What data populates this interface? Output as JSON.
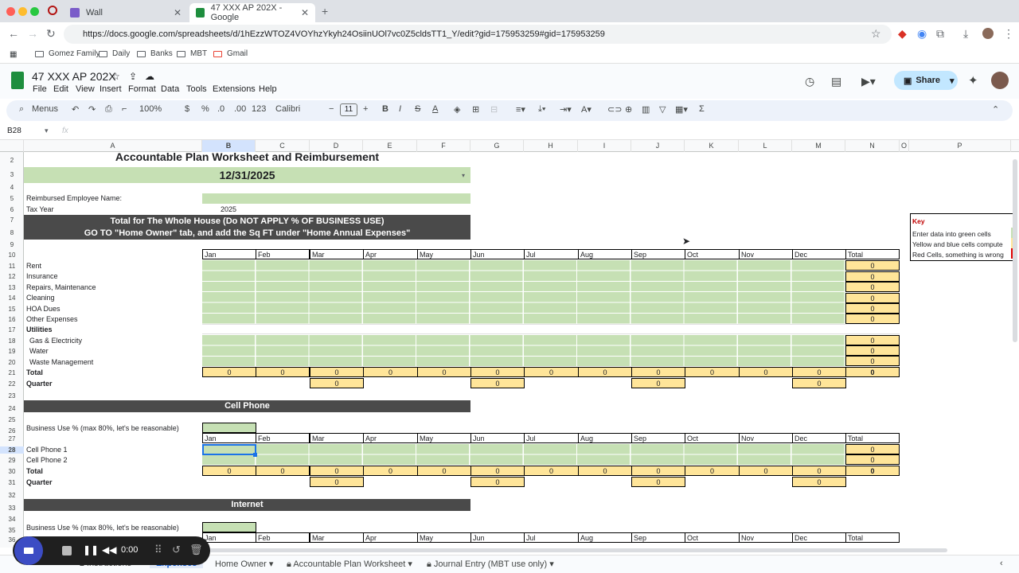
{
  "browser": {
    "tab1": "Wall",
    "tab2": "47 XXX AP 202X - Google",
    "url": "https://docs.google.com/spreadsheets/d/1hEzzWTOZ4VOYhzYkyh24OsiinUOl7vc0Z5cldsTT1_Y/edit?gid=175953259#gid=175953259",
    "bookmarks": [
      "Gomez Family",
      "Daily",
      "Banks",
      "MBT",
      "Gmail"
    ]
  },
  "doc": {
    "title": "47 XXX AP 202X",
    "menus": [
      "File",
      "Edit",
      "View",
      "Insert",
      "Format",
      "Data",
      "Tools",
      "Extensions",
      "Help"
    ],
    "share": "Share"
  },
  "toolbar": {
    "menus": "Menus",
    "zoom": "100%",
    "dollar": "$",
    "percent": "%",
    "dec_less": ".0",
    "dec_more": ".00",
    "numfmt": "123",
    "font": "Calibri",
    "size": "11"
  },
  "formula": {
    "cellref": "B28"
  },
  "columns": [
    "A",
    "B",
    "C",
    "D",
    "E",
    "F",
    "G",
    "H",
    "I",
    "J",
    "K",
    "L",
    "M",
    "N",
    "O",
    "P"
  ],
  "rows": [
    "2",
    "3",
    "4",
    "5",
    "6",
    "7",
    "8",
    "9",
    "10",
    "11",
    "12",
    "13",
    "14",
    "15",
    "16",
    "17",
    "18",
    "19",
    "20",
    "21",
    "22",
    "23",
    "24",
    "25",
    "26",
    "27",
    "28",
    "29",
    "30",
    "31",
    "32",
    "33",
    "34",
    "35",
    "36"
  ],
  "sheet": {
    "title": "Accountable Plan Worksheet and Reimbursement",
    "date": "12/31/2025",
    "emp_label": "Reimbursed Employee Name:",
    "taxyear_label": "Tax Year",
    "taxyear": "2025",
    "banner1": "Total for The Whole House (Do NOT APPLY % OF BUSINESS USE)",
    "banner2": "GO TO \"Home Owner\" tab, and add the Sq FT under \"Home Annual Expenses\"",
    "months": [
      "Jan",
      "Feb",
      "Mar",
      "Apr",
      "May",
      "Jun",
      "Jul",
      "Aug",
      "Sep",
      "Oct",
      "Nov",
      "Dec",
      "Total"
    ],
    "house_rows": [
      "Rent",
      "Insurance",
      "Repairs, Maintenance",
      "Cleaning",
      "HOA Dues",
      "Other Expenses",
      "Utilities",
      "Gas & Electricity",
      "Water",
      "Waste Management"
    ],
    "total": "Total",
    "quarter": "Quarter",
    "zero": "0",
    "cell_title": "Cell Phone",
    "biz_label": "Business Use % (max 80%, let's be reasonable)",
    "cell_rows": [
      "Cell Phone 1",
      "Cell Phone 2"
    ],
    "internet_title": "Internet"
  },
  "key": {
    "title": "Key",
    "l1": "Enter data into green cells",
    "l2": "Yellow and blue cells compute",
    "l3": "Red Cells, something is wrong"
  },
  "tabs": [
    "Instructions",
    "Expenses",
    "Home Owner",
    "Accountable Plan Worksheet",
    "Journal Entry (MBT use only)"
  ],
  "recorder": {
    "time": "0:00"
  }
}
